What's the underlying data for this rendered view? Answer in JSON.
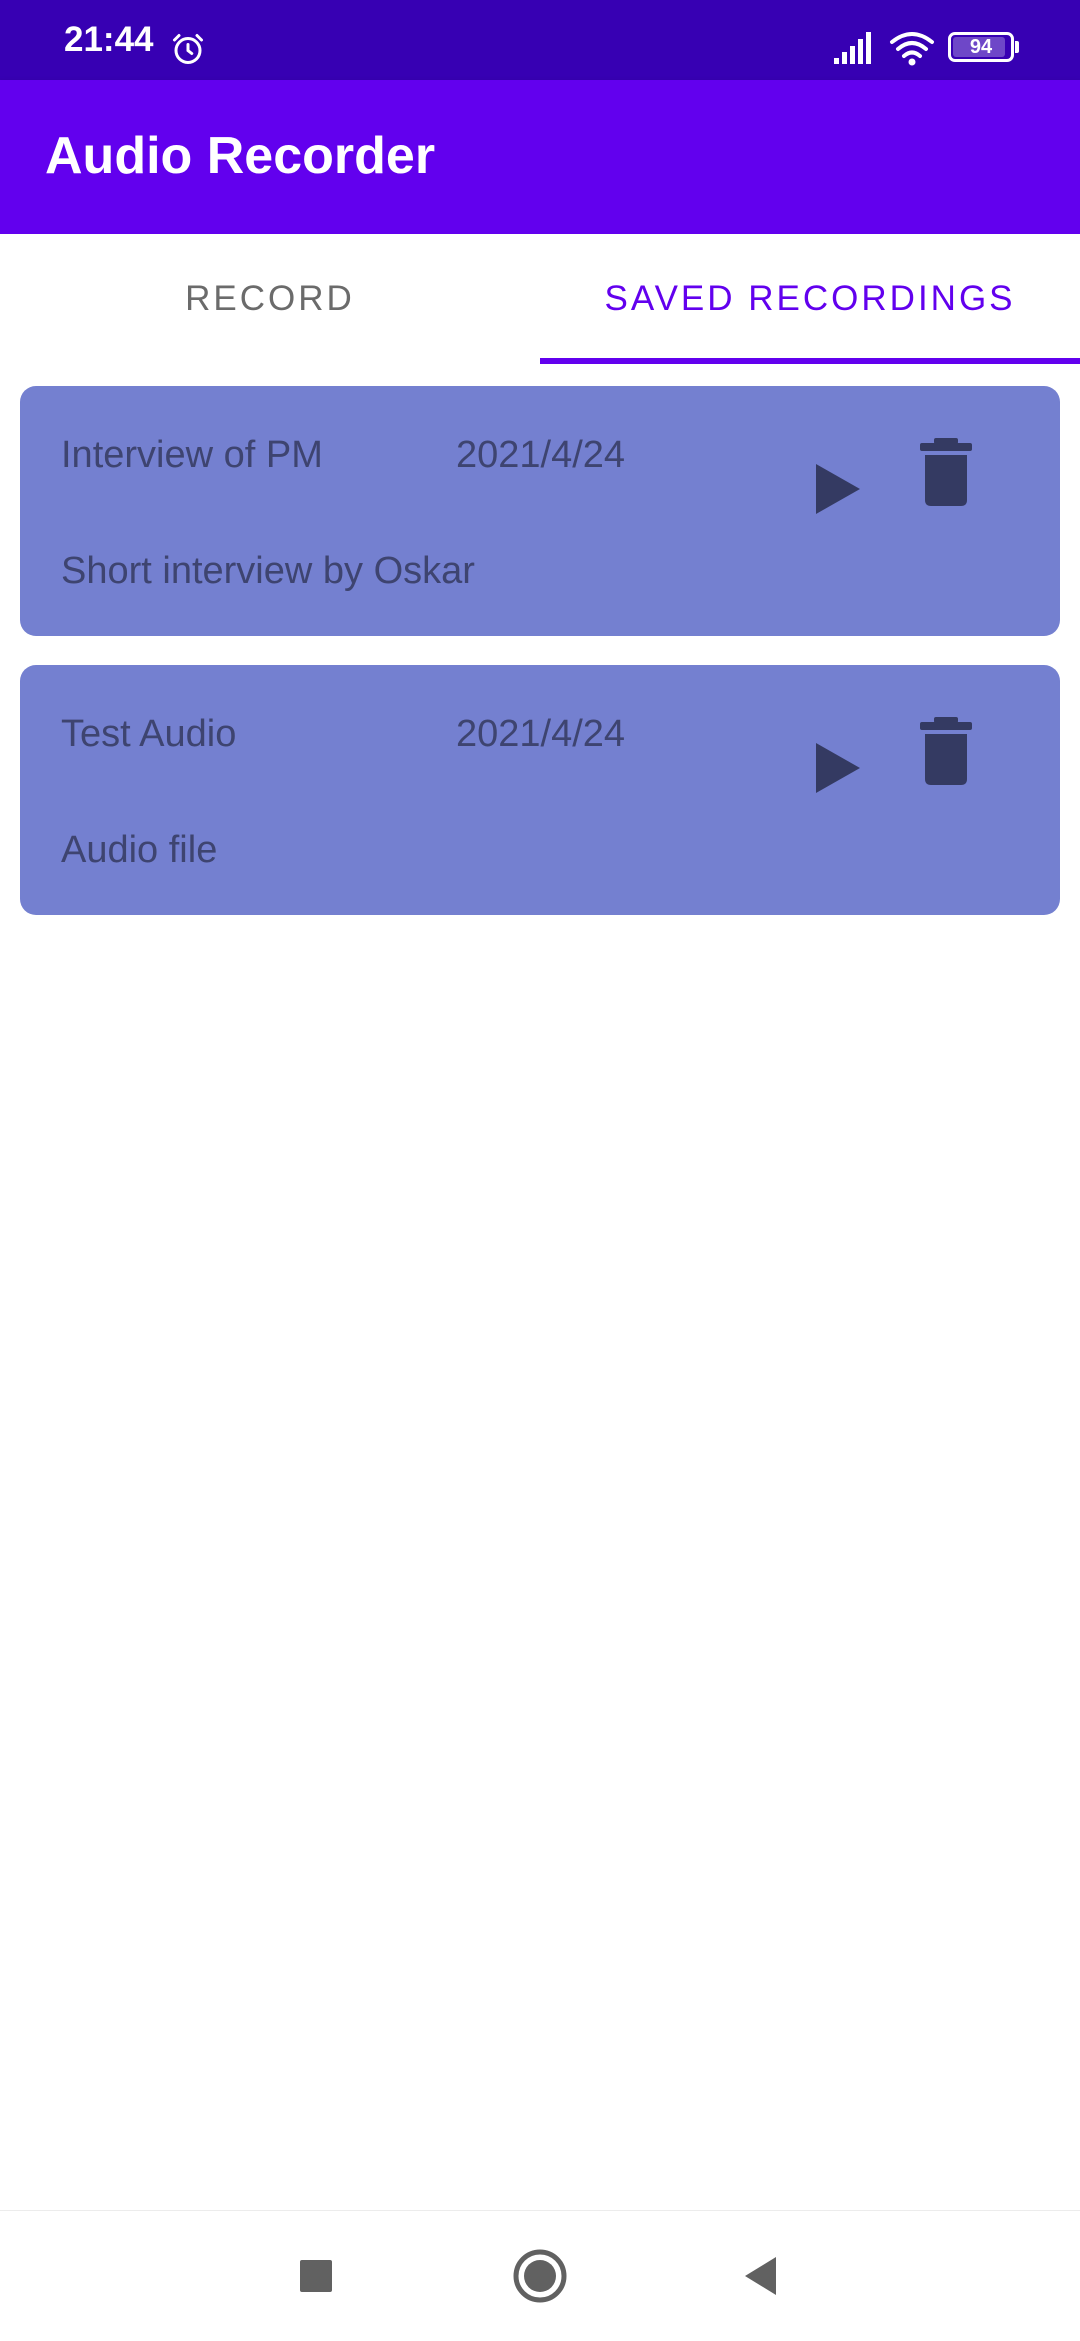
{
  "status_bar": {
    "time": "21:44",
    "battery": "94",
    "icons": [
      "alarm-icon",
      "signal-icon",
      "wifi-icon",
      "battery-icon"
    ]
  },
  "app_bar": {
    "title": "Audio Recorder",
    "color": "#6200ee"
  },
  "tabs": [
    {
      "label": "RECORD",
      "selected": false
    },
    {
      "label": "SAVED RECORDINGS",
      "selected": true
    }
  ],
  "recordings": [
    {
      "title": "Interview of PM",
      "date": "2021/4/24",
      "description": "Short interview by Oskar",
      "actions": [
        "play-icon",
        "delete-icon"
      ]
    },
    {
      "title": "Test Audio",
      "date": "2021/4/24",
      "description": "Audio file",
      "actions": [
        "play-icon",
        "delete-icon"
      ]
    }
  ],
  "colors": {
    "status_bar": "#3700b3",
    "accent": "#6200ee",
    "card_background": "#7480d0",
    "card_text": "#3e4470"
  },
  "nav_bar": {
    "buttons": [
      "recents-icon",
      "home-icon",
      "back-icon"
    ]
  }
}
